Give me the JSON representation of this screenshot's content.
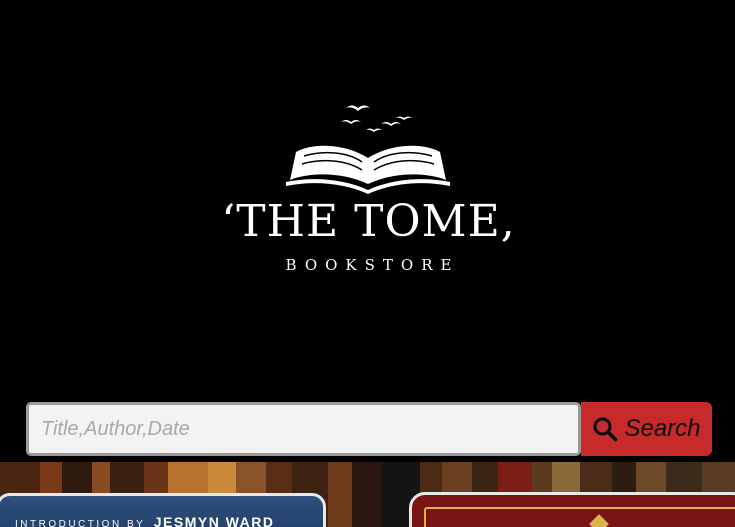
{
  "logo": {
    "title": "‘THE TOME,",
    "subtitle": "BOOKSTORE"
  },
  "search": {
    "placeholder": "Title,Author,Date",
    "value": "",
    "button_label": "Search",
    "button_color": "#c72a2a"
  },
  "featured": {
    "left_book": {
      "intro_label": "INTRODUCTION BY",
      "intro_name": "JESMYN WARD"
    }
  },
  "colors": {
    "background": "#000000",
    "accent": "#c72a2a"
  }
}
